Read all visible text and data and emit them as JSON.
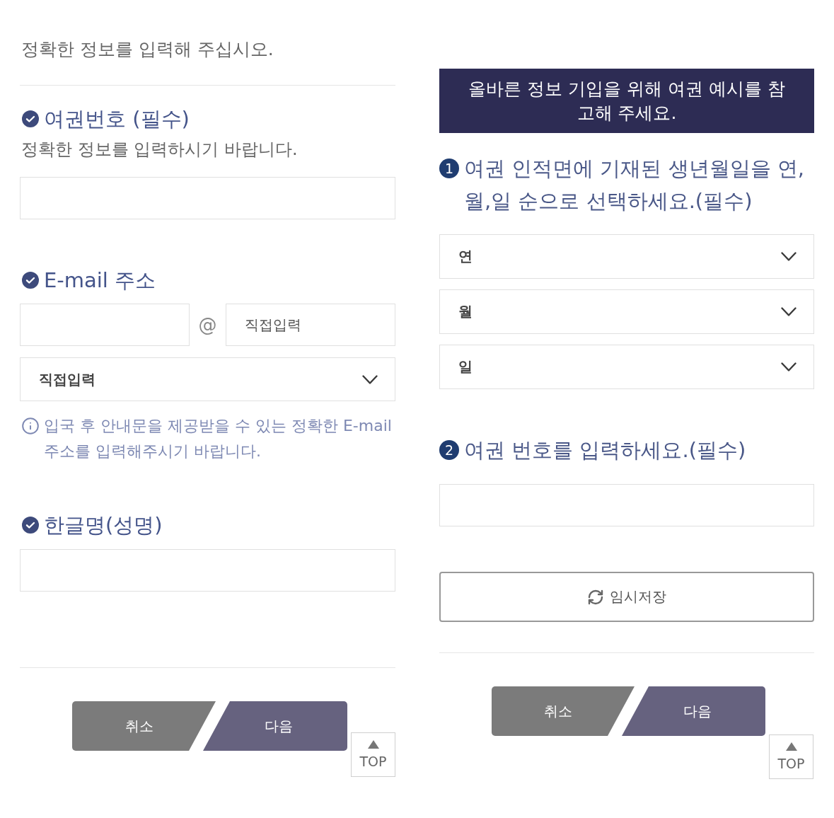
{
  "left_form": {
    "intro": "정확한 정보를 입력해 주십시오.",
    "fields": [
      {
        "kind": "text",
        "label": "여권번호 (필수)",
        "hint": "정확한 정보를 입력하시기 바랍니다."
      },
      {
        "kind": "email",
        "label": "E-mail 주소",
        "at_sign": "@",
        "domain_placeholder": "직접입력",
        "domain_select": "직접입력",
        "notice": "입국 후 안내문을 제공받을 수 있는 정확한 E-mail 주소를 입력해주시기 바랍니다."
      },
      {
        "kind": "text",
        "label": "한글명(성명)"
      }
    ],
    "buttons": [
      {
        "kind": "cancel",
        "label": "취소"
      },
      {
        "kind": "next",
        "label": "다음"
      }
    ],
    "top_button": "TOP"
  },
  "right_form": {
    "banner": "올바른 정보 기입을 위해 여권 예시를 참고해 주세요.",
    "steps": [
      {
        "kind": "date",
        "number": "1",
        "title": "여권 인적면에 기재된 생년월일을 연,월,일 순으로 선택하세요.(필수)",
        "selects": [
          "연",
          "월",
          "일"
        ]
      },
      {
        "kind": "text",
        "number": "2",
        "title": "여권 번호를 입력하세요.(필수)"
      }
    ],
    "save_button": "임시저장",
    "buttons": [
      {
        "kind": "cancel",
        "label": "취소"
      },
      {
        "kind": "next",
        "label": "다음"
      }
    ],
    "top_button": "TOP"
  }
}
